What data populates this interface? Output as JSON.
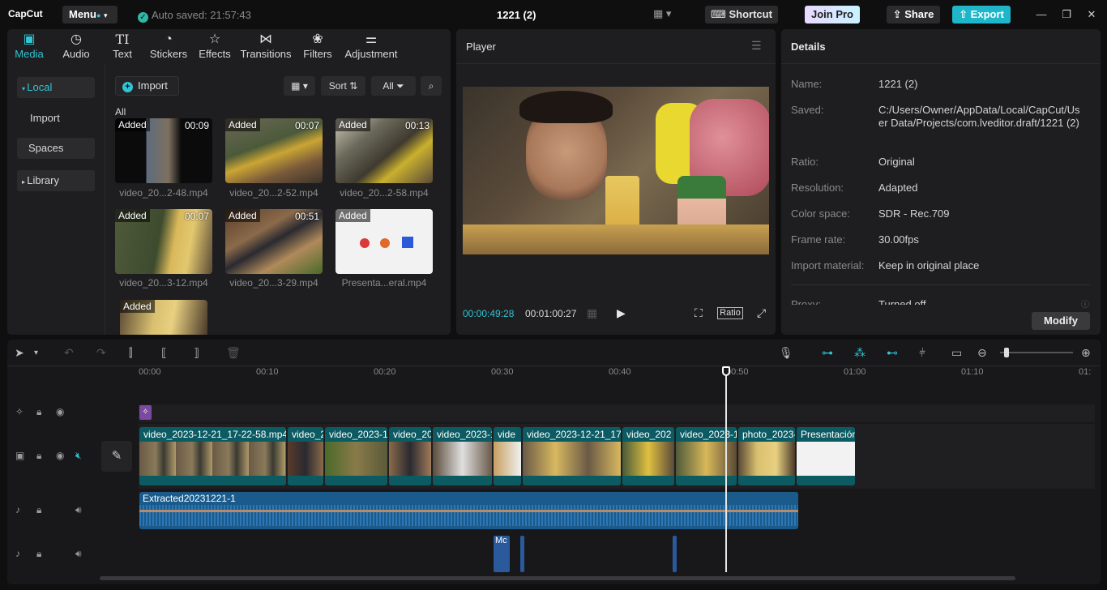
{
  "topbar": {
    "logo": "CapCut",
    "menu_label": "Menu",
    "autosave": "Auto saved: 21:57:43",
    "project_title": "1221 (2)",
    "shortcut_label": "Shortcut",
    "joinpro_label": "Join Pro",
    "share_label": "Share",
    "export_label": "Export"
  },
  "media_tabs": [
    {
      "label": "Media",
      "icon": "media-icon",
      "active": true
    },
    {
      "label": "Audio",
      "icon": "audio-icon"
    },
    {
      "label": "Text",
      "icon": "text-icon"
    },
    {
      "label": "Stickers",
      "icon": "stickers-icon"
    },
    {
      "label": "Effects",
      "icon": "effects-icon"
    },
    {
      "label": "Transitions",
      "icon": "transitions-icon"
    },
    {
      "label": "Filters",
      "icon": "filters-icon"
    },
    {
      "label": "Adjustment",
      "icon": "adjustment-icon"
    }
  ],
  "media_nav": {
    "local": "Local",
    "import": "Import",
    "spaces": "Spaces",
    "library": "Library"
  },
  "media_toolbar": {
    "import_label": "Import",
    "sort_label": "Sort",
    "filter_label": "All",
    "all_heading": "All"
  },
  "media_items": [
    {
      "badge": "Added",
      "duration": "00:09",
      "name": "video_20...2-48.mp4"
    },
    {
      "badge": "Added",
      "duration": "00:07",
      "name": "video_20...2-52.mp4"
    },
    {
      "badge": "Added",
      "duration": "00:13",
      "name": "video_20...2-58.mp4"
    },
    {
      "badge": "Added",
      "duration": "00:07",
      "name": "video_20...3-12.mp4"
    },
    {
      "badge": "Added",
      "duration": "00:51",
      "name": "video_20...3-29.mp4"
    },
    {
      "badge": "Added",
      "duration": "",
      "name": "Presenta...eral.mp4"
    },
    {
      "badge": "Added",
      "duration": "",
      "name": ""
    }
  ],
  "player": {
    "title": "Player",
    "current_time": "00:00:49:28",
    "total_time": "00:01:00:27",
    "ratio_label": "Ratio"
  },
  "details": {
    "title": "Details",
    "rows": [
      {
        "label": "Name:",
        "value": "1221 (2)"
      },
      {
        "label": "Saved:",
        "value": "C:/Users/Owner/AppData/Local/CapCut/User Data/Projects/com.lveditor.draft/1221 (2)"
      },
      {
        "label": "Ratio:",
        "value": "Original"
      },
      {
        "label": "Resolution:",
        "value": "Adapted"
      },
      {
        "label": "Color space:",
        "value": "SDR - Rec.709"
      },
      {
        "label": "Frame rate:",
        "value": "30.00fps"
      },
      {
        "label": "Import material:",
        "value": "Keep in original place"
      },
      {
        "label": "Proxy:",
        "value": "Turned off"
      }
    ],
    "modify_label": "Modify"
  },
  "timeline": {
    "ruler_ticks": [
      "00:00",
      "00:10",
      "00:20",
      "00:30",
      "00:40",
      "00:50",
      "01:00",
      "01:10",
      "01:"
    ],
    "clips": [
      "video_2023-12-21_17-22-58.mp4",
      "video_2",
      "video_2023-1",
      "video_20",
      "video_2023-1",
      "vide",
      "video_2023-12-21_17-",
      "video_202",
      "video_2023-1",
      "photo_2023-",
      "Presentación"
    ],
    "audio_clip": "Extracted20231221-1",
    "small_clip": "Mc"
  },
  "colors": {
    "accent": "#2fc5d5",
    "video_track": "#0c5b63",
    "audio_track": "#1a5b8c",
    "export": "#1fb6c9"
  }
}
